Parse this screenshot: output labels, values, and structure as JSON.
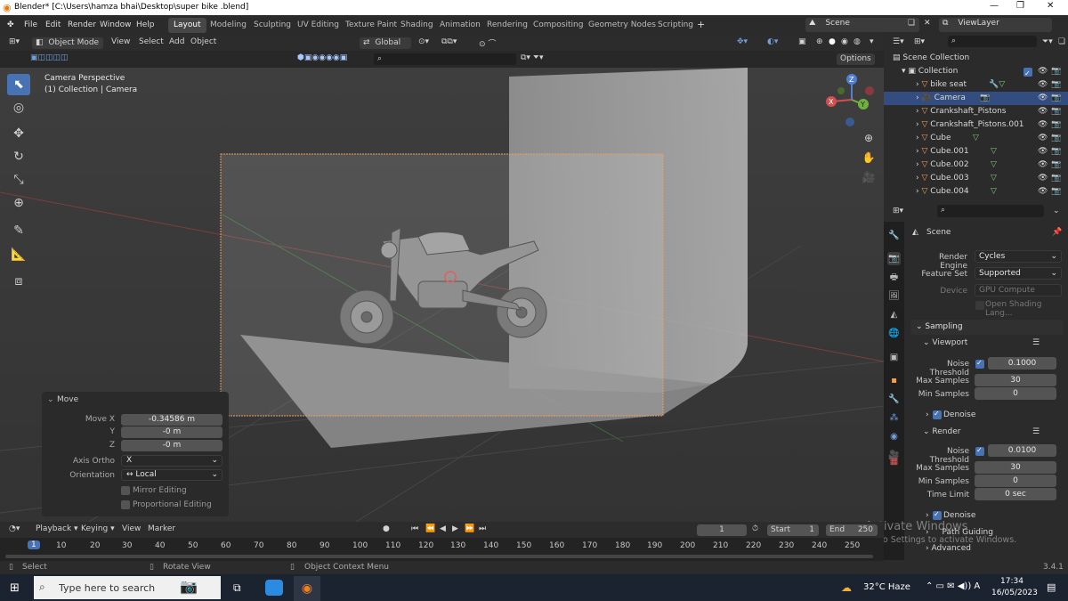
{
  "window": {
    "title": "Blender* [C:\\Users\\hamza bhai\\Desktop\\super bike .blend]"
  },
  "menus": [
    "File",
    "Edit",
    "Render",
    "Window",
    "Help"
  ],
  "workspaces": [
    "Layout",
    "Modeling",
    "Sculpting",
    "UV Editing",
    "Texture Paint",
    "Shading",
    "Animation",
    "Rendering",
    "Compositing",
    "Geometry Nodes",
    "Scripting"
  ],
  "top_right": {
    "scene": "Scene",
    "view_layer": "ViewLayer"
  },
  "viewport_header": {
    "mode": "Object Mode",
    "menus": [
      "View",
      "Select",
      "Add",
      "Object"
    ],
    "transform": "Global",
    "options": "Options"
  },
  "viewport": {
    "camera_perspective": "Camera Perspective",
    "collection": "(1) Collection | Camera"
  },
  "move_panel": {
    "title": "Move",
    "x_label": "Move X",
    "x_value": "-0.34586 m",
    "y_label": "Y",
    "y_value": "-0 m",
    "z_label": "Z",
    "z_value": "-0 m",
    "axis_ortho_label": "Axis Ortho",
    "axis_ortho_value": "X",
    "orientation_label": "Orientation",
    "orientation_value": "Local",
    "mirror_editing": "Mirror Editing",
    "proportional_editing": "Proportional Editing"
  },
  "outliner": {
    "scene_collection": "Scene Collection",
    "collection": "Collection",
    "items": [
      "bike seat",
      "Camera",
      "Crankshaft_Pistons",
      "Crankshaft_Pistons.001",
      "Cube",
      "Cube.001",
      "Cube.002",
      "Cube.003",
      "Cube.004"
    ]
  },
  "properties": {
    "context": "Scene",
    "render_engine_label": "Render Engine",
    "render_engine": "Cycles",
    "feature_set_label": "Feature Set",
    "feature_set": "Supported",
    "device_label": "Device",
    "device": "GPU Compute",
    "open_shading": "Open Shading Lang...",
    "sampling": "Sampling",
    "viewport": "Viewport",
    "noise_threshold_label": "Noise Threshold",
    "vp_noise_threshold": "0.1000",
    "max_samples_label": "Max Samples",
    "vp_max_samples": "30",
    "min_samples_label": "Min Samples",
    "vp_min_samples": "0",
    "denoise": "Denoise",
    "render": "Render",
    "r_noise_threshold": "0.0100",
    "r_max_samples": "30",
    "r_min_samples": "0",
    "time_limit_label": "Time Limit",
    "time_limit": "0 sec",
    "denoise2": "Denoise",
    "path_guiding": "Path Guiding",
    "advanced": "Advanced",
    "activate1": "Activate Windows",
    "activate2": "Go to Settings to activate Windows."
  },
  "timeline": {
    "menus": [
      "Playback",
      "Keying",
      "View",
      "Marker"
    ],
    "current_frame": "1",
    "start_label": "Start",
    "start": "1",
    "end_label": "End",
    "end": "250",
    "ticks": [
      "1",
      "10",
      "20",
      "30",
      "40",
      "50",
      "60",
      "70",
      "80",
      "90",
      "100",
      "110",
      "120",
      "130",
      "140",
      "150",
      "160",
      "170",
      "180",
      "190",
      "200",
      "210",
      "220",
      "230",
      "240",
      "250"
    ]
  },
  "statusbar": {
    "select": "Select",
    "rotate": "Rotate View",
    "context": "Object Context Menu",
    "version": "3.4.1"
  },
  "taskbar": {
    "search_placeholder": "Type here to search",
    "weather": "32°C  Haze",
    "time": "17:34",
    "date": "16/05/2023"
  }
}
